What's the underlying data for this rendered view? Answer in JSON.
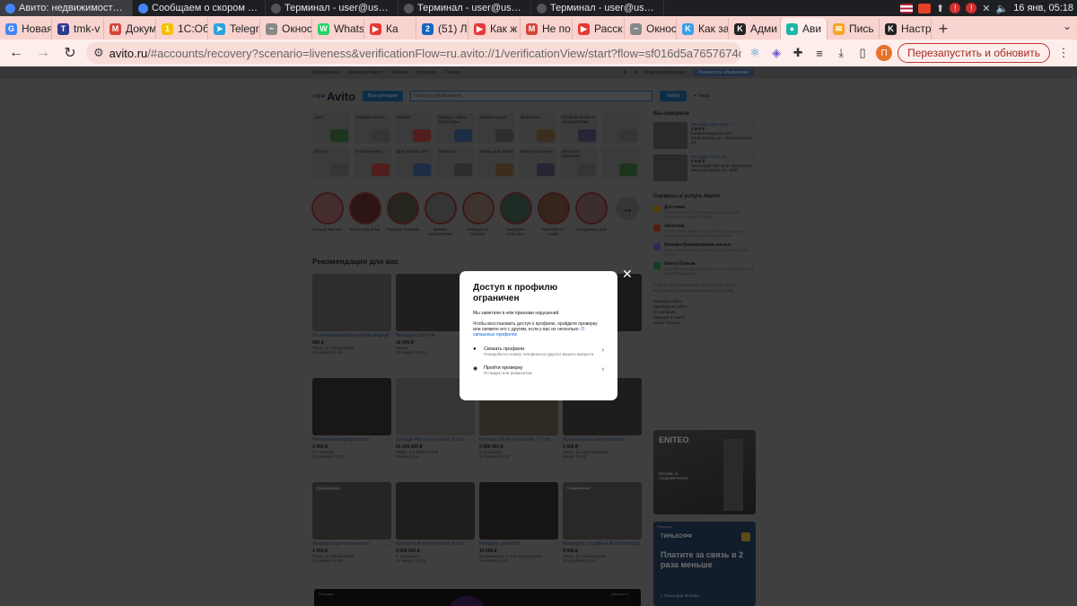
{
  "taskbar": {
    "tasks": [
      {
        "title": "Авито: недвижимость, тра...",
        "color": "#4285f4"
      },
      {
        "title": "Сообщаем о скором удале...",
        "color": "#4285f4"
      },
      {
        "title": "Терминал - user@user-oem...",
        "color": "#555555"
      },
      {
        "title": "Терминал - user@user-oem...",
        "color": "#555555"
      },
      {
        "title": "Терминал - user@user-oem...",
        "color": "#555555"
      }
    ],
    "clock": "16 янв, 05:18"
  },
  "tabs": [
    {
      "label": "Новая",
      "color": "#4285f4",
      "glyph": "G"
    },
    {
      "label": "tmk-v",
      "color": "#2e3a8c",
      "glyph": "T"
    },
    {
      "label": "Докум",
      "color": "#d44638",
      "glyph": "M"
    },
    {
      "label": "1С:Об",
      "color": "#f2c200",
      "glyph": "1"
    },
    {
      "label": "Telegr",
      "color": "#2aa3e0",
      "glyph": "➤"
    },
    {
      "label": "Окнос",
      "color": "#888888",
      "glyph": "~"
    },
    {
      "label": "Whats",
      "color": "#25d366",
      "glyph": "W"
    },
    {
      "label": "Ка",
      "color": "#e53935",
      "glyph": "▶"
    },
    {
      "label": "(51) Л",
      "color": "#1565c0",
      "glyph": "2"
    },
    {
      "label": "Как ж",
      "color": "#e53935",
      "glyph": "▶"
    },
    {
      "label": "Не по",
      "color": "#d44638",
      "glyph": "M"
    },
    {
      "label": "Расск",
      "color": "#e53935",
      "glyph": "▶"
    },
    {
      "label": "Окнос",
      "color": "#888888",
      "glyph": "~"
    },
    {
      "label": "Как за",
      "color": "#3aa0e8",
      "glyph": "K"
    },
    {
      "label": "Адми",
      "color": "#222222",
      "glyph": "K"
    },
    {
      "label": "Ави",
      "color": "#1bb6a6",
      "glyph": "●",
      "active": true
    },
    {
      "label": "Пись",
      "color": "#f5a623",
      "glyph": "✉"
    },
    {
      "label": "Настр",
      "color": "#222222",
      "glyph": "K"
    }
  ],
  "address": {
    "host": "avito.ru",
    "path": "/#accounts/recovery?scenario=liveness&verificationFlow=ru.avito://1/verificationView/start?flow=sf016d5a7657674c303836...",
    "relaunch_label": "Перезапустить и обновить",
    "profile_initial": "П"
  },
  "avito": {
    "topnav": [
      "Для бизнеса",
      "Карьера в Авито",
      "Помощь",
      "Каталоги",
      "Польза"
    ],
    "login": "Вход и регистрация",
    "post_ad": "Разместить объявление",
    "logo": "Avito",
    "all_categories": "Все категории",
    "search_placeholder": "Поиск по объявлениям",
    "find": "Найти",
    "city": "Тверь",
    "categories_row1": [
      "Авто",
      "Недвижи-мость",
      "Работа",
      "Одежда, обувь, аксессуары",
      "Хобби и отдых",
      "Животные",
      "Готовый бизнес и оборудование",
      ""
    ],
    "categories_row2": [
      "Услуги",
      "Электро-ника",
      "Для дома и дачи",
      "Запчасти",
      "Товары для детей",
      "Жильё посуточно",
      "Красота и здоровье",
      ""
    ],
    "stories": [
      "Больше вкусого",
      "Кинотеатр дома",
      "Подарки близким",
      "Зимние развлечения",
      "Каникулы в столице",
      "Покупайте спокойно",
      "Помогайте с нами",
      "Арендовать дом"
    ],
    "rec_title": "Рекомендации для вас",
    "products": [
      {
        "title": "Петличный микрофон беспроводной",
        "price": "680 ₽",
        "meta": "Тверь, р-н Московский",
        "date": "14 января 01:05",
        "badge": ""
      },
      {
        "title": "Рекордер zoom H4",
        "price": "16 400 ₽",
        "meta": "Анапа",
        "date": "15 января 23:33",
        "badge": ""
      },
      {
        "title": "",
        "price": "",
        "meta": "",
        "date": "",
        "badge": ""
      },
      {
        "title": "",
        "price": "",
        "meta": "",
        "date": "",
        "badge": ""
      },
      {
        "title": "Петличный микрофон boya",
        "price": "3 900 ₽",
        "meta": "пгт. Максим",
        "date": "29 декабря 22:20",
        "badge": ""
      },
      {
        "title": "Коттедж 440 м² на участке 9 сот.",
        "price": "51 000 000 ₽",
        "meta": "Тверь, р-н Заволжский",
        "date": "Вчера 20:34",
        "badge": ""
      },
      {
        "title": "Коттедж 155 м² на участке 7,7 сот.",
        "price": "5 990 000 ₽",
        "meta": "д. Бородино",
        "date": "14 января 15:22",
        "badge": ""
      },
      {
        "title": "Музыкальный центр samsung",
        "price": "3 000 ₽",
        "meta": "Тверь, р-н Центральный",
        "date": "Вчера 16:23",
        "badge": ""
      },
      {
        "title": "Микрофон для компьютера",
        "price": "1 000 ₽",
        "meta": "Тверь, р-н Московский",
        "date": "14 января 15:09",
        "badge": "Продвижение"
      },
      {
        "title": "Коттедж 140 м² на участке 8 сот.",
        "price": "9 000 000 ₽",
        "meta": "п. Калашово",
        "date": "12 января 11:44",
        "badge": ""
      },
      {
        "title": "Рекордер zoom h2n",
        "price": "10 000 ₽",
        "meta": "Калининград, р-н Ленинградский",
        "date": "9 января 21:40",
        "badge": ""
      },
      {
        "title": "Микрофон студийный Audio-technica",
        "price": "9 000 ₽",
        "meta": "Тверь, р-н Московский",
        "date": "18 декабря 20:39",
        "badge": "Продвижение"
      }
    ],
    "viewed_title": "Вы смотрели",
    "viewed": [
      {
        "title": "Рекордер диктофон z...",
        "price": "4 500 ₽",
        "meta": "Калининградская обл., Калининград, ул. Черняховского, 34"
      },
      {
        "title": "Рекордер Zoom H1",
        "price": "5 000 ₽",
        "meta": "Краснодарский край, Краснодар, Мелиоративная ул., 55/5"
      }
    ],
    "services_title": "Сервисы и услуги Авито",
    "services": [
      {
        "title": "Доставка",
        "desc": "Проверка при получении и возможность бесплатно вернуть товар",
        "color": "#a47a14"
      },
      {
        "title": "Автотека",
        "desc": "Отчёт с историей авто: пробег, владельцы, сведения о залоге, ДТП и ремонтах",
        "color": "#a33a2a"
      },
      {
        "title": "Онлайн-бронирование жилья",
        "desc": "Посуточная аренда квартир и домов по всей России",
        "color": "#6a4aa8"
      },
      {
        "title": "Авито Польза",
        "desc": "Сделайте вклад в помощь тем, кто нуждается в вашей поддержке",
        "color": "#2f7a3f"
      }
    ],
    "copyright": "© ООО «КЕХ еКоммерц» 2007–2024. Авито использует рекомендательные технологии",
    "footer_links": [
      "Правила Авито",
      "Реклама на сайте",
      "О компании",
      "Карьера в Авито",
      "Авито Польза"
    ],
    "ad1_brand": "ENITEO",
    "ad1_caption": "Москва, м. Академическая",
    "ad2_label": "Реклама",
    "ad2_brand": "ТИНЬКОФФ",
    "ad2_text": "Платите за связь в 2 раза меньше",
    "ad2_sub": "с Тинькофф Мобайл",
    "promo_label": "Реклама",
    "promo_domain": "ultasans.ru"
  },
  "modal": {
    "title": "Доступ к профилю ограничен",
    "p1": "Мы заметили в нём признаки нарушений.",
    "p2": "Чтобы восстановить доступ к профилю, пройдите проверку или свяжите его с другим, если у вас их несколько.",
    "p2_link": "О связанных профилях",
    "options": [
      {
        "title": "Связать профили",
        "sub": "Понадобится номер телефона из другого вашего аккаунта",
        "icon": "person-icon"
      },
      {
        "title": "Пройти проверку",
        "sub": "По видео или реквизитам",
        "icon": "check-shield-icon"
      }
    ]
  }
}
